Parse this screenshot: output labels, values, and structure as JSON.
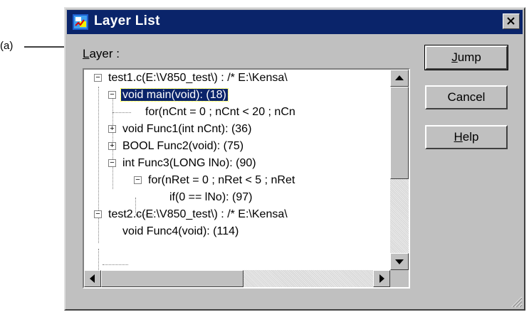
{
  "annotation": {
    "label": "(a)"
  },
  "window": {
    "title": "Layer List"
  },
  "layer_label": {
    "mnemonic": "L",
    "rest": "ayer :"
  },
  "tree": {
    "items": [
      {
        "text": "test1.c(E:\\V850_test\\) : /* E:\\Kensa\\",
        "expander": "−"
      },
      {
        "text": "void main(void): (18)",
        "expander": "−",
        "selected": true
      },
      {
        "text": "for(nCnt = 0 ; nCnt < 20 ; nCn",
        "expander": ""
      },
      {
        "text": "void Func1(int nCnt): (36)",
        "expander": "+"
      },
      {
        "text": "BOOL Func2(void): (75)",
        "expander": "+"
      },
      {
        "text": "int Func3(LONG lNo): (90)",
        "expander": "−"
      },
      {
        "text": "for(nRet = 0 ; nRet < 5 ; nRet",
        "expander": "−"
      },
      {
        "text": "if(0 == lNo): (97)",
        "expander": ""
      },
      {
        "text": "test2.c(E:\\V850_test\\) : /* E:\\Kensa\\",
        "expander": "−"
      },
      {
        "text": "void Func4(void): (114)",
        "expander": ""
      }
    ]
  },
  "buttons": {
    "jump": {
      "mnemonic": "J",
      "rest": "ump"
    },
    "cancel": {
      "label": "Cancel"
    },
    "help": {
      "mnemonic": "H",
      "rest": "elp"
    }
  },
  "colors": {
    "titlebar": "#0a246a",
    "face": "#c0c0c0",
    "selection": "#0a246a"
  },
  "icons": [
    "window-app-icon",
    "close-icon",
    "scroll-up-icon",
    "scroll-down-icon",
    "scroll-left-icon",
    "scroll-right-icon",
    "resize-grip-icon"
  ]
}
